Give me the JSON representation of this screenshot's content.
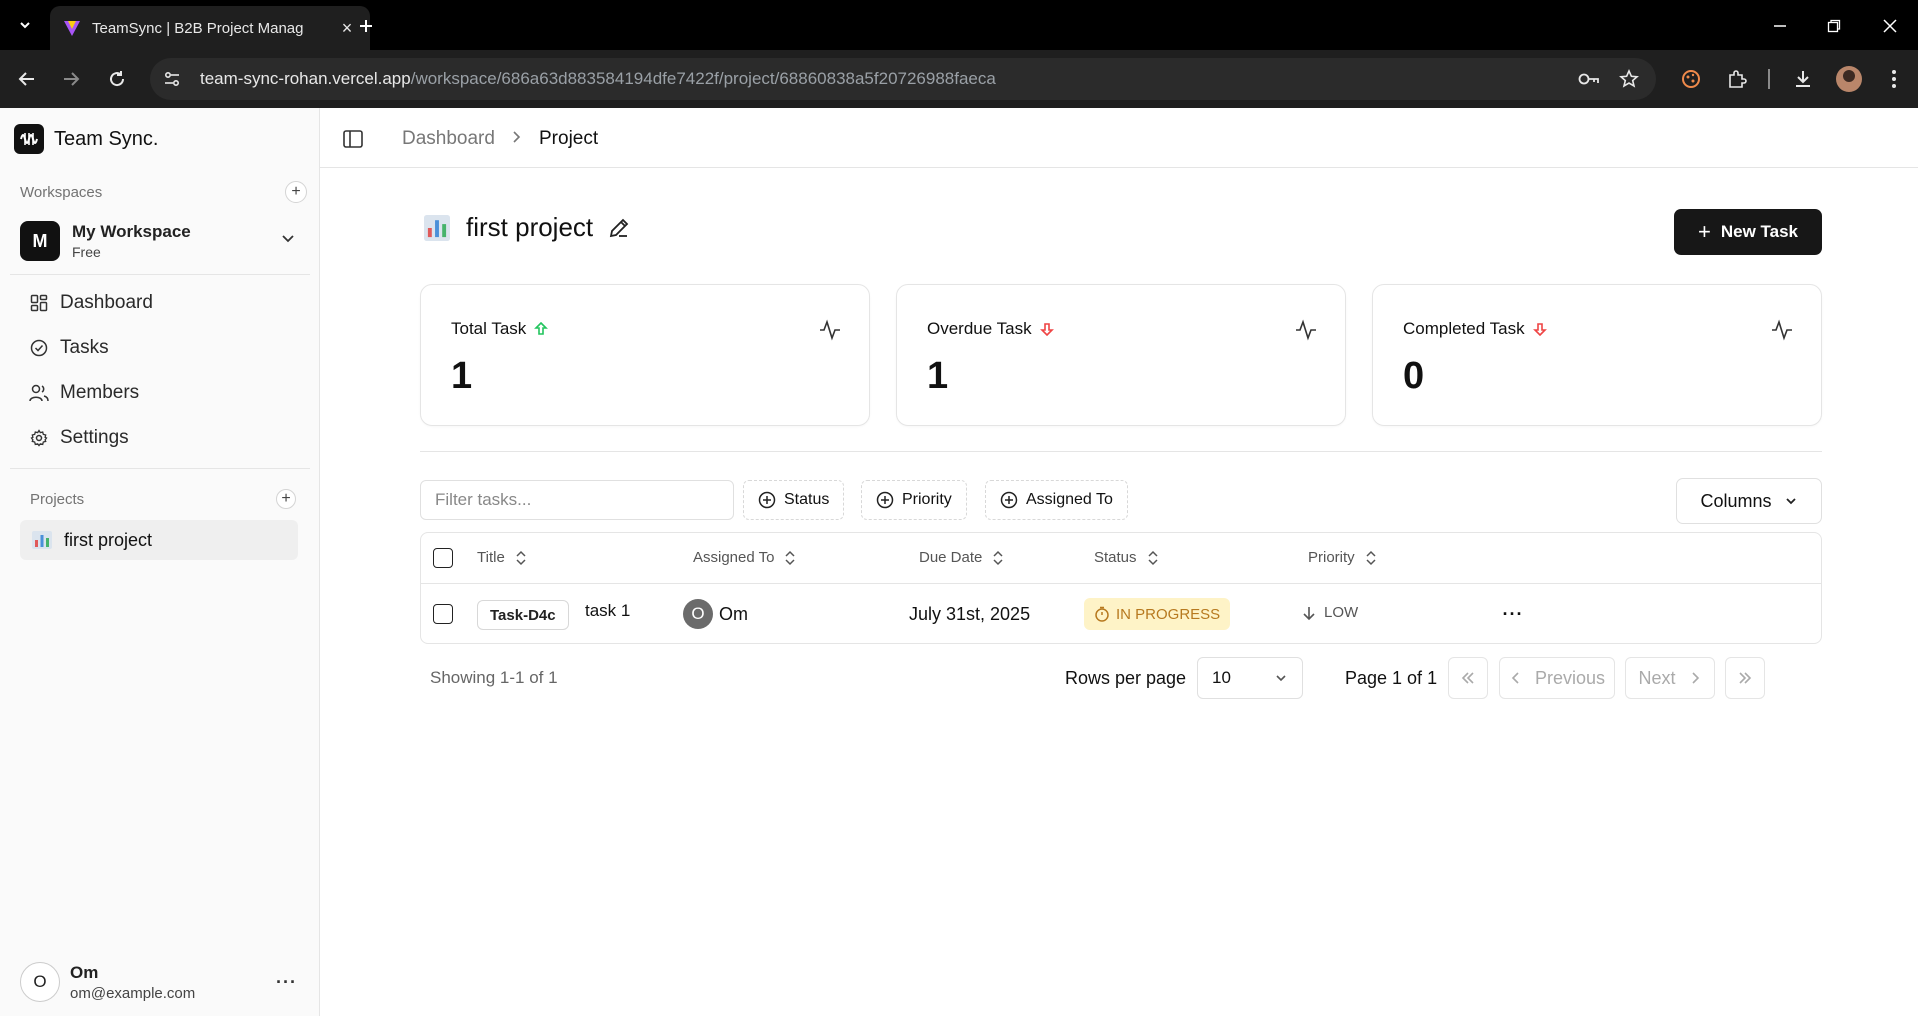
{
  "browser": {
    "tab_title": "TeamSync | B2B Project Manag",
    "url_host": "team-sync-rohan.vercel.app",
    "url_path": "/workspace/686a63d883584194dfe7422f/project/68860838a5f20726988faeca"
  },
  "brand": {
    "name": "Team Sync."
  },
  "sidebar": {
    "workspaces_label": "Workspaces",
    "workspace": {
      "initial": "M",
      "name": "My Workspace",
      "plan": "Free"
    },
    "nav": [
      {
        "label": "Dashboard",
        "icon": "dashboard-icon"
      },
      {
        "label": "Tasks",
        "icon": "tasks-icon"
      },
      {
        "label": "Members",
        "icon": "members-icon"
      },
      {
        "label": "Settings",
        "icon": "settings-icon"
      }
    ],
    "projects_label": "Projects",
    "projects": [
      {
        "label": "first project",
        "icon": "bar-chart-emoji"
      }
    ],
    "user": {
      "initial": "O",
      "name": "Om",
      "email": "om@example.com"
    }
  },
  "breadcrumb": {
    "parent": "Dashboard",
    "current": "Project"
  },
  "project": {
    "title": "first project",
    "new_task_label": "New Task"
  },
  "stats": [
    {
      "label": "Total Task",
      "value": "1",
      "trend": "up",
      "trend_color": "#22c55e"
    },
    {
      "label": "Overdue Task",
      "value": "1",
      "trend": "down",
      "trend_color": "#ef4444"
    },
    {
      "label": "Completed Task",
      "value": "0",
      "trend": "down",
      "trend_color": "#ef4444"
    }
  ],
  "filters": {
    "search_placeholder": "Filter tasks...",
    "status": "Status",
    "priority": "Priority",
    "assigned_to": "Assigned To",
    "columns": "Columns"
  },
  "table": {
    "headers": {
      "title": "Title",
      "assigned_to": "Assigned To",
      "due_date": "Due Date",
      "status": "Status",
      "priority": "Priority"
    },
    "rows": [
      {
        "code": "Task-D4c",
        "title": "task 1",
        "assignee_initial": "O",
        "assignee": "Om",
        "due_date": "July 31st, 2025",
        "status": "IN PROGRESS",
        "priority": "LOW"
      }
    ]
  },
  "pagination": {
    "showing": "Showing 1-1 of 1",
    "rows_per_page_label": "Rows per page",
    "rows_per_page": "10",
    "page": "Page 1 of 1",
    "previous": "Previous",
    "next": "Next"
  },
  "colors": {
    "accent": "#171717",
    "status_bg": "#fef3c7",
    "status_text": "#b7791f",
    "sidebar_bg": "#fafafa"
  }
}
